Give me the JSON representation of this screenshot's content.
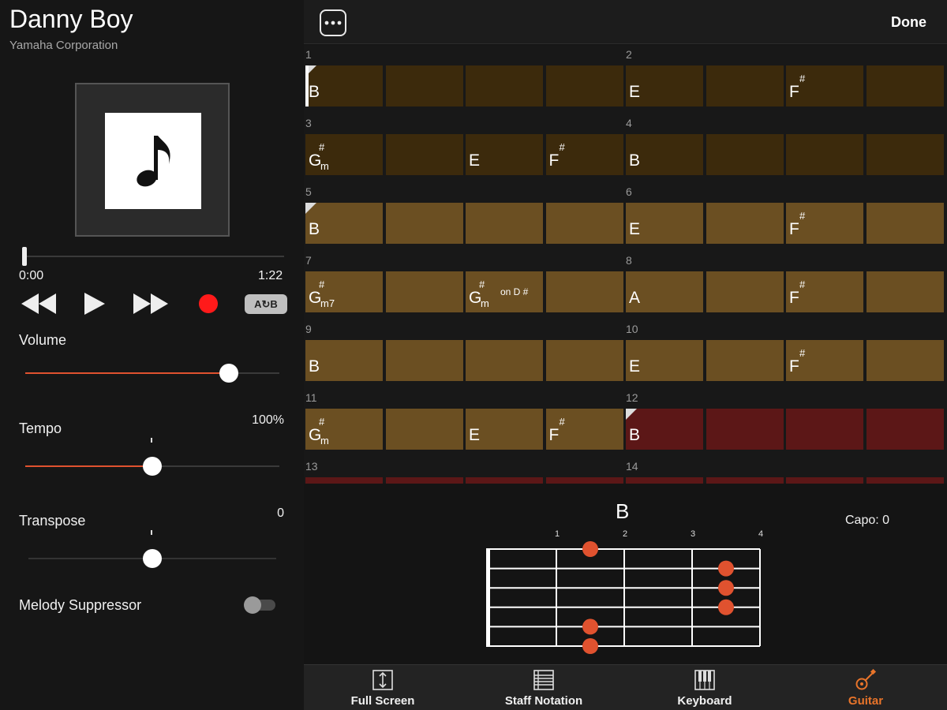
{
  "song": {
    "title": "Danny Boy",
    "artist": "Yamaha Corporation"
  },
  "player": {
    "time_current": "0:00",
    "time_total": "1:22",
    "progress": 0.0,
    "ab_label": "A↻B"
  },
  "settings": {
    "volume": {
      "label": "Volume",
      "level": 0.8
    },
    "tempo": {
      "label": "Tempo",
      "value": "100%",
      "level": 0.5
    },
    "transpose": {
      "label": "Transpose",
      "value": "0",
      "level": 0.5
    },
    "melody_suppressor": {
      "label": "Melody Suppressor",
      "on": false
    }
  },
  "topbar": {
    "done_label": "Done"
  },
  "measures": [
    {
      "num": "1",
      "row": 0,
      "col": 0,
      "cells": [
        {
          "root": "B",
          "shade": "dark",
          "corner": true,
          "cursor": true
        },
        {
          "shade": "dark"
        },
        {
          "shade": "dark"
        },
        {
          "shade": "dark"
        }
      ]
    },
    {
      "num": "2",
      "row": 0,
      "col": 1,
      "cells": [
        {
          "root": "E",
          "shade": "dark"
        },
        {
          "shade": "dark"
        },
        {
          "root": "F",
          "sharp": "#",
          "shade": "dark"
        },
        {
          "shade": "dark"
        }
      ]
    },
    {
      "num": "3",
      "row": 1,
      "col": 0,
      "cells": [
        {
          "root": "G",
          "sharp": "#",
          "sub": "m",
          "shade": "dark"
        },
        {
          "shade": "dark"
        },
        {
          "root": "E",
          "shade": "dark"
        },
        {
          "root": "F",
          "sharp": "#",
          "shade": "dark"
        }
      ]
    },
    {
      "num": "4",
      "row": 1,
      "col": 1,
      "cells": [
        {
          "root": "B",
          "shade": "dark"
        },
        {
          "shade": "dark"
        },
        {
          "shade": "dark"
        },
        {
          "shade": "dark"
        }
      ]
    },
    {
      "num": "5",
      "row": 2,
      "col": 0,
      "cells": [
        {
          "root": "B",
          "shade": "light",
          "corner": true
        },
        {
          "shade": "light"
        },
        {
          "shade": "light"
        },
        {
          "shade": "light"
        }
      ]
    },
    {
      "num": "6",
      "row": 2,
      "col": 1,
      "cells": [
        {
          "root": "E",
          "shade": "light"
        },
        {
          "shade": "light"
        },
        {
          "root": "F",
          "sharp": "#",
          "shade": "light"
        },
        {
          "shade": "light"
        }
      ]
    },
    {
      "num": "7",
      "row": 3,
      "col": 0,
      "cells": [
        {
          "root": "G",
          "sharp": "#",
          "sub": "m7",
          "shade": "light"
        },
        {
          "shade": "light"
        },
        {
          "root": "G",
          "sharp": "#",
          "sub": "m",
          "on": "on D #",
          "shade": "light"
        },
        {
          "shade": "light"
        }
      ]
    },
    {
      "num": "8",
      "row": 3,
      "col": 1,
      "cells": [
        {
          "root": "A",
          "shade": "light"
        },
        {
          "shade": "light"
        },
        {
          "root": "F",
          "sharp": "#",
          "shade": "light"
        },
        {
          "shade": "light"
        }
      ]
    },
    {
      "num": "9",
      "row": 4,
      "col": 0,
      "cells": [
        {
          "root": "B",
          "shade": "light"
        },
        {
          "shade": "light"
        },
        {
          "shade": "light"
        },
        {
          "shade": "light"
        }
      ]
    },
    {
      "num": "10",
      "row": 4,
      "col": 1,
      "cells": [
        {
          "root": "E",
          "shade": "light"
        },
        {
          "shade": "light"
        },
        {
          "root": "F",
          "sharp": "#",
          "shade": "light"
        },
        {
          "shade": "light"
        }
      ]
    },
    {
      "num": "11",
      "row": 5,
      "col": 0,
      "cells": [
        {
          "root": "G",
          "sharp": "#",
          "sub": "m",
          "shade": "light"
        },
        {
          "shade": "light"
        },
        {
          "root": "E",
          "shade": "light"
        },
        {
          "root": "F",
          "sharp": "#",
          "shade": "light"
        }
      ]
    },
    {
      "num": "12",
      "row": 5,
      "col": 1,
      "cells": [
        {
          "root": "B",
          "shade": "red",
          "corner": true
        },
        {
          "shade": "red"
        },
        {
          "shade": "red"
        },
        {
          "shade": "red"
        }
      ]
    },
    {
      "num": "13",
      "row": 6,
      "col": 0,
      "cells": [
        {
          "shade": "red"
        },
        {
          "shade": "red"
        },
        {
          "shade": "red"
        },
        {
          "shade": "red"
        }
      ]
    },
    {
      "num": "14",
      "row": 6,
      "col": 1,
      "cells": [
        {
          "shade": "red"
        },
        {
          "shade": "red"
        },
        {
          "shade": "red"
        },
        {
          "shade": "red"
        }
      ]
    }
  ],
  "guitar_diagram": {
    "chord": "B",
    "capo_label": "Capo: 0",
    "fret_numbers": [
      "1",
      "2",
      "3",
      "4"
    ],
    "dots": [
      {
        "string": 1,
        "fret": 2
      },
      {
        "string": 2,
        "fret": 4
      },
      {
        "string": 3,
        "fret": 4
      },
      {
        "string": 4,
        "fret": 4
      },
      {
        "string": 5,
        "fret": 2
      },
      {
        "string": 6,
        "fret": 2
      }
    ]
  },
  "nav": [
    {
      "label": "Full Screen",
      "icon": "full-screen-icon",
      "active": false
    },
    {
      "label": "Staff Notation",
      "icon": "staff-notation-icon",
      "active": false
    },
    {
      "label": "Keyboard",
      "icon": "keyboard-icon",
      "active": false
    },
    {
      "label": "Guitar",
      "icon": "guitar-icon",
      "active": true
    }
  ],
  "colors": {
    "accent": "#e0522f",
    "active_nav": "#e8742a",
    "dot": "#e0522f",
    "record": "#ff1a1a"
  }
}
